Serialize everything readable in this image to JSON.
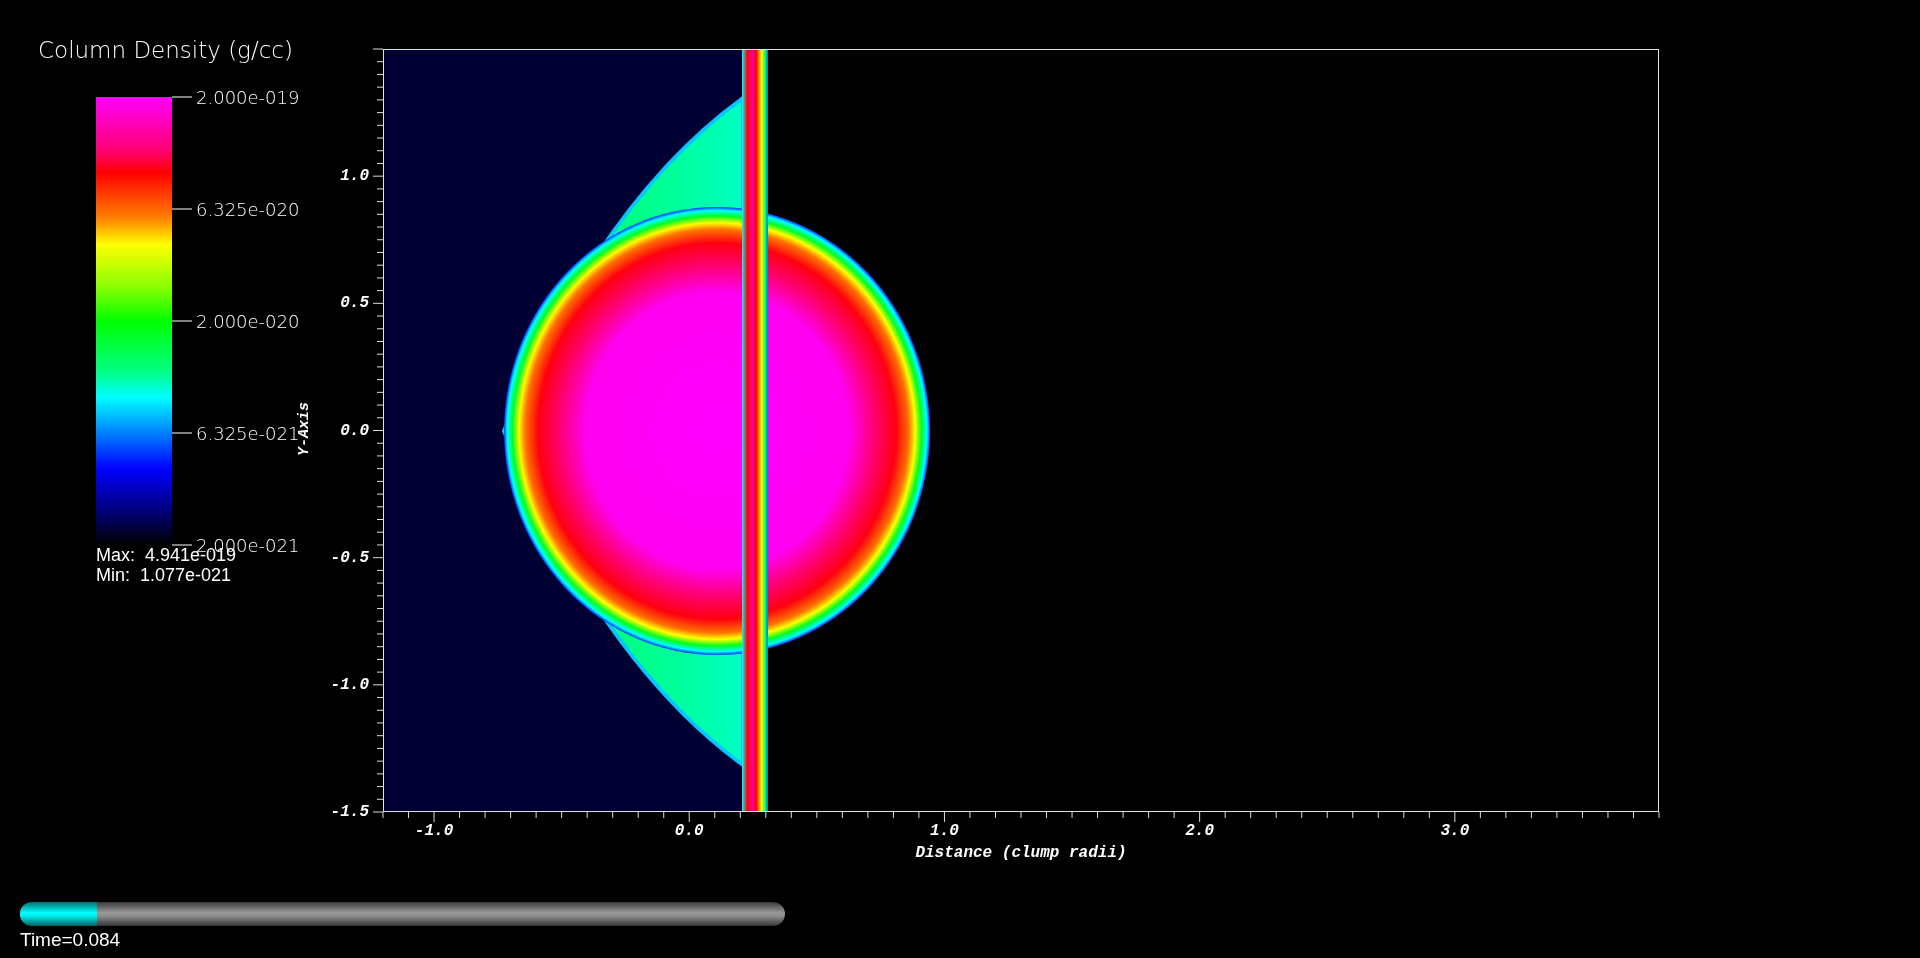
{
  "legend": {
    "title": "Column Density (g/cc)",
    "ticks": [
      "2.000e-019",
      "6.325e-020",
      "2.000e-020",
      "6.325e-021",
      "2.000e-021"
    ],
    "max": "Max:  4.941e-019",
    "min": "Min:  1.077e-021"
  },
  "plot": {
    "y_axis": {
      "title": "Y-Axis",
      "ticks": [
        "1.0",
        "0.5",
        "0.0",
        "-0.5",
        "-1.0",
        "-1.5"
      ]
    },
    "x_axis": {
      "title": "Distance (clump radii)",
      "ticks": [
        "-1.0",
        "0.0",
        "1.0",
        "2.0",
        "3.0"
      ]
    }
  },
  "time_slider": {
    "level": 0.1,
    "label": "Time=0.084"
  }
}
